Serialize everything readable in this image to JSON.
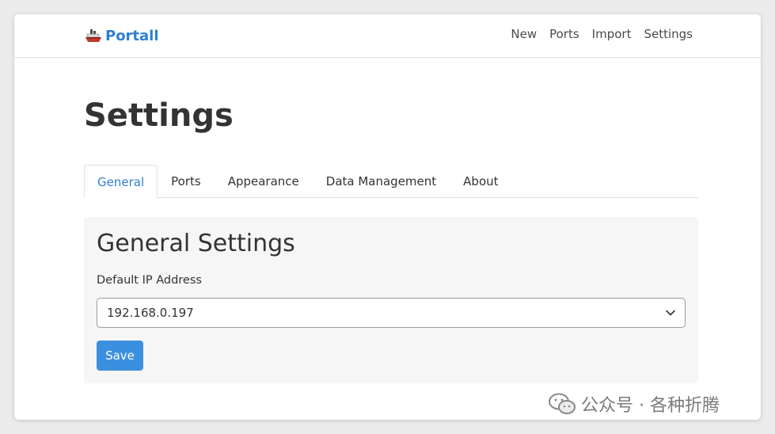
{
  "brand": {
    "name": "Portall",
    "icon": "ship-icon",
    "color": "#2f80d1"
  },
  "nav": {
    "links": [
      {
        "label": "New"
      },
      {
        "label": "Ports"
      },
      {
        "label": "Import"
      },
      {
        "label": "Settings"
      }
    ]
  },
  "page": {
    "title": "Settings"
  },
  "tabs": [
    {
      "label": "General",
      "active": true
    },
    {
      "label": "Ports",
      "active": false
    },
    {
      "label": "Appearance",
      "active": false
    },
    {
      "label": "Data Management",
      "active": false
    },
    {
      "label": "About",
      "active": false
    }
  ],
  "general": {
    "heading": "General Settings",
    "ip_label": "Default IP Address",
    "ip_value": "192.168.0.197",
    "save_label": "Save"
  },
  "watermark": {
    "text": "公众号 · 各种折腾",
    "icon": "wechat-icon"
  },
  "colors": {
    "accent": "#2f80d1",
    "button": "#3b8fe0",
    "card_bg": "#f6f6f6"
  }
}
